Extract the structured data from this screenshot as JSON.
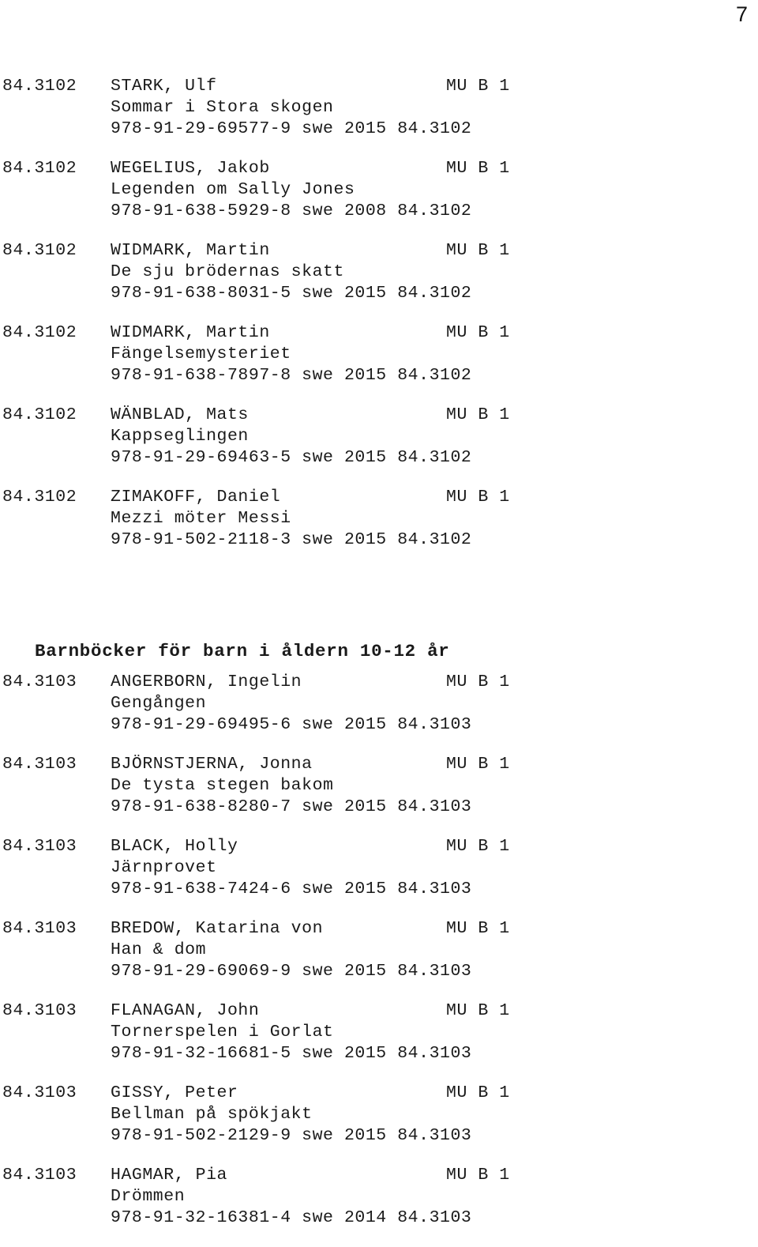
{
  "page": {
    "number": "7"
  },
  "sections": [
    {
      "heading": null,
      "entries": [
        {
          "classification": "84.3102",
          "author": "STARK, Ulf",
          "code": "MU B 1",
          "title": "Sommar i Stora skogen",
          "isbn_line": "978-91-29-69577-9 swe 2015 84.3102",
          "isbn": "978-91-29-69577-9",
          "language": "swe",
          "year": "2015",
          "classification_repeat": "84.3102"
        },
        {
          "classification": "84.3102",
          "author": "WEGELIUS, Jakob",
          "code": "MU B 1",
          "title": "Legenden om Sally Jones",
          "isbn_line": "978-91-638-5929-8 swe 2008 84.3102",
          "isbn": "978-91-638-5929-8",
          "language": "swe",
          "year": "2008",
          "classification_repeat": "84.3102"
        },
        {
          "classification": "84.3102",
          "author": "WIDMARK, Martin",
          "code": "MU B 1",
          "title": "De sju brödernas skatt",
          "isbn_line": "978-91-638-8031-5 swe 2015 84.3102",
          "isbn": "978-91-638-8031-5",
          "language": "swe",
          "year": "2015",
          "classification_repeat": "84.3102"
        },
        {
          "classification": "84.3102",
          "author": "WIDMARK, Martin",
          "code": "MU B 1",
          "title": "Fängelsemysteriet",
          "isbn_line": "978-91-638-7897-8 swe 2015 84.3102",
          "isbn": "978-91-638-7897-8",
          "language": "swe",
          "year": "2015",
          "classification_repeat": "84.3102"
        },
        {
          "classification": "84.3102",
          "author": "WÄNBLAD, Mats",
          "code": "MU B 1",
          "title": "Kappseglingen",
          "isbn_line": "978-91-29-69463-5 swe 2015 84.3102",
          "isbn": "978-91-29-69463-5",
          "language": "swe",
          "year": "2015",
          "classification_repeat": "84.3102"
        },
        {
          "classification": "84.3102",
          "author": "ZIMAKOFF, Daniel",
          "code": "MU B 1",
          "title": "Mezzi möter Messi",
          "isbn_line": "978-91-502-2118-3 swe 2015 84.3102",
          "isbn": "978-91-502-2118-3",
          "language": "swe",
          "year": "2015",
          "classification_repeat": "84.3102"
        }
      ]
    },
    {
      "heading": "Barnböcker för barn i åldern 10-12 år",
      "entries": [
        {
          "classification": "84.3103",
          "author": "ANGERBORN, Ingelin",
          "code": "MU B 1",
          "title": "Gengången",
          "isbn_line": "978-91-29-69495-6 swe 2015 84.3103",
          "isbn": "978-91-29-69495-6",
          "language": "swe",
          "year": "2015",
          "classification_repeat": "84.3103"
        },
        {
          "classification": "84.3103",
          "author": "BJÖRNSTJERNA, Jonna",
          "code": "MU B 1",
          "title": "De tysta stegen bakom",
          "isbn_line": "978-91-638-8280-7 swe 2015 84.3103",
          "isbn": "978-91-638-8280-7",
          "language": "swe",
          "year": "2015",
          "classification_repeat": "84.3103"
        },
        {
          "classification": "84.3103",
          "author": "BLACK, Holly",
          "code": "MU B 1",
          "title": "Järnprovet",
          "isbn_line": "978-91-638-7424-6 swe 2015 84.3103",
          "isbn": "978-91-638-7424-6",
          "language": "swe",
          "year": "2015",
          "classification_repeat": "84.3103"
        },
        {
          "classification": "84.3103",
          "author": "BREDOW, Katarina von",
          "code": "MU B 1",
          "title": "Han & dom",
          "isbn_line": "978-91-29-69069-9 swe 2015 84.3103",
          "isbn": "978-91-29-69069-9",
          "language": "swe",
          "year": "2015",
          "classification_repeat": "84.3103"
        },
        {
          "classification": "84.3103",
          "author": "FLANAGAN, John",
          "code": "MU B 1",
          "title": "Tornerspelen i Gorlat",
          "isbn_line": "978-91-32-16681-5 swe 2015 84.3103",
          "isbn": "978-91-32-16681-5",
          "language": "swe",
          "year": "2015",
          "classification_repeat": "84.3103"
        },
        {
          "classification": "84.3103",
          "author": "GISSY, Peter",
          "code": "MU B 1",
          "title": "Bellman på spökjakt",
          "isbn_line": "978-91-502-2129-9 swe 2015 84.3103",
          "isbn": "978-91-502-2129-9",
          "language": "swe",
          "year": "2015",
          "classification_repeat": "84.3103"
        },
        {
          "classification": "84.3103",
          "author": "HAGMAR, Pia",
          "code": "MU B 1",
          "title": "Drömmen",
          "isbn_line": "978-91-32-16381-4 swe 2014 84.3103",
          "isbn": "978-91-32-16381-4",
          "language": "swe",
          "year": "2014",
          "classification_repeat": "84.3103"
        }
      ]
    }
  ]
}
